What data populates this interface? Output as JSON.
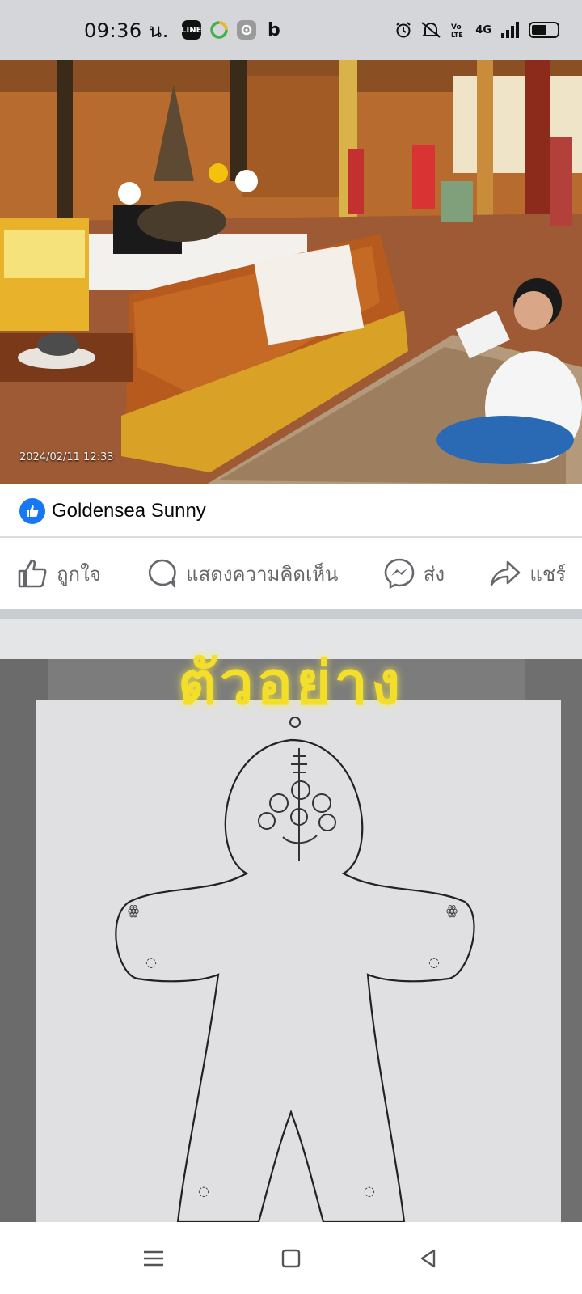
{
  "status_bar": {
    "time": "09:36 น.",
    "apps": [
      "LINE",
      "circle-app",
      "settings-app",
      "b-app"
    ],
    "network": "4G",
    "battery_percent": 60
  },
  "post1": {
    "photo_timestamp": "2024/02/11 12:33",
    "author": "Goldensea Sunny",
    "actions": {
      "like": "ถูกใจ",
      "comment": "แสดงความคิดเห็น",
      "send": "ส่ง",
      "share": "แชร์"
    }
  },
  "post2": {
    "title": "ตัวอย่าง"
  },
  "nav": {
    "icons": [
      "menu-icon",
      "home-square-icon",
      "back-triangle-icon"
    ]
  },
  "colors": {
    "status_bg": "#d4d6d9",
    "facebook_blue": "#1877f2",
    "action_gray": "#65676b",
    "title_yellow": "#f3de2a"
  }
}
